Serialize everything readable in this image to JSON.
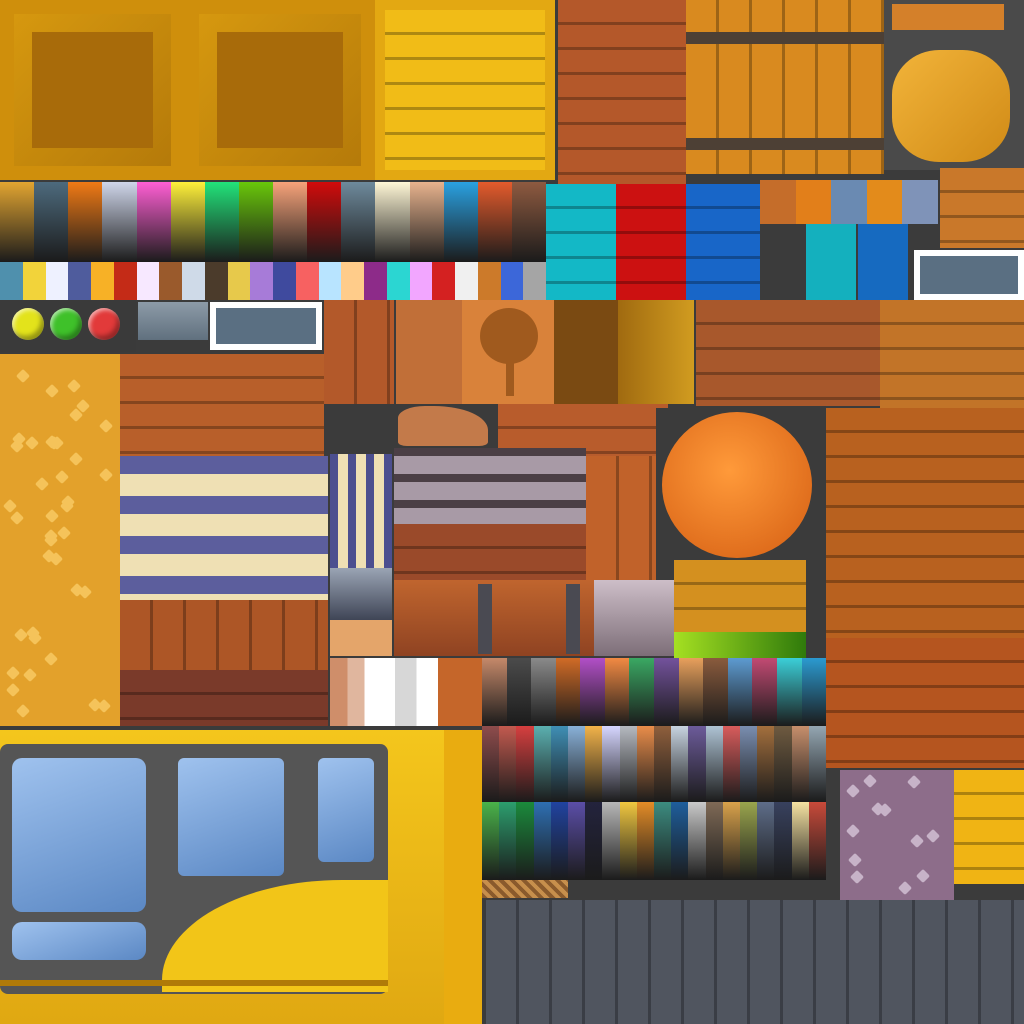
{
  "palette": {
    "wood_yellow": "#e0a012",
    "wood_yellow_dark": "#b57a0a",
    "wood_light": "#f3c21c",
    "wood_orange": "#c8692a",
    "wood_brown": "#8a4520",
    "wood_dark": "#6a3a1f",
    "metal": "#5a5a5a",
    "teal": "#13b8c6",
    "red": "#cc1111",
    "blue": "#1866c8",
    "truck_yellow": "#f2c518",
    "window_blue": "#6f9fd9",
    "frame_gray": "#555555",
    "panel_gray": "#50555f",
    "pumpkin": "#ee7a1a",
    "pink_stone": "#8d6d8a",
    "sand": "#e7a12b",
    "cloth_blue": "#5c5e9d",
    "cloth_cream": "#efe0b4"
  },
  "gradient_swatches_top": [
    "#e2a531",
    "#4d6a7d",
    "#f07a15",
    "#cfd6ea",
    "#ff5fd4",
    "#fff03a",
    "#22e37a",
    "#69c70a",
    "#f7a37a",
    "#d10b0b",
    "#6e8a9c",
    "#fff7d6",
    "#e8b38e",
    "#2aa1e1",
    "#e45b2c",
    "#8e5a40"
  ],
  "gradient_swatches_bottom": [
    "#4f90ad",
    "#f2d33a",
    "#eef1ff",
    "#4f5c9d",
    "#f7b126",
    "#c42b17",
    "#f7e8ff",
    "#9a5a2c",
    "#cfdae8",
    "#4b3b2b",
    "#e7c94b",
    "#a77bd8",
    "#3f4a9e",
    "#f76161",
    "#b8e4ff",
    "#ffcc8a",
    "#8d2b89",
    "#2bd6d2",
    "#f2a6ff",
    "#d42121",
    "#f0f0f0",
    "#cc7a2a",
    "#3c67d9",
    "#a5a5a5"
  ],
  "palette_mid": [
    "#c5896a",
    "#4b4b4b",
    "#8a8a8a",
    "#d06b26",
    "#b24fc7",
    "#f28a43",
    "#3aa863",
    "#73529c",
    "#e8a05c",
    "#8a5b3d",
    "#5d9bd1",
    "#c24a73",
    "#3bcfd8",
    "#2b9ad0"
  ],
  "palette_row1": [
    "#8e4c4c",
    "#c25a4f",
    "#d63f3f",
    "#5bb0b0",
    "#3f8fb5",
    "#89b1d8",
    "#f2b34a",
    "#d6d6ff",
    "#b5b9c0",
    "#e98d4a",
    "#8f5f3c",
    "#c7d3e0",
    "#6c5b9a",
    "#aec3d4",
    "#d85c5c",
    "#7a8eb0",
    "#a36f3d",
    "#6e5a40",
    "#c78f6c",
    "#94a6b2"
  ],
  "palette_row2": [
    "#4ab34a",
    "#2c9e6e",
    "#1b8a3c",
    "#2e6fb2",
    "#2043a0",
    "#5b4ea8",
    "#23233d",
    "#b7b7b7",
    "#f0c740",
    "#e38c27",
    "#3c8c80",
    "#1e5e9c",
    "#c9c9c9",
    "#7f6a56",
    "#d9a24b",
    "#9aa54d",
    "#5e6d89",
    "#38415e",
    "#f5e2a2",
    "#c84a3a"
  ],
  "small_swatches_right": [
    "#c56d2a",
    "#e27f1a",
    "#6a8ab2",
    "#e38b1b",
    "#7f93b8"
  ]
}
